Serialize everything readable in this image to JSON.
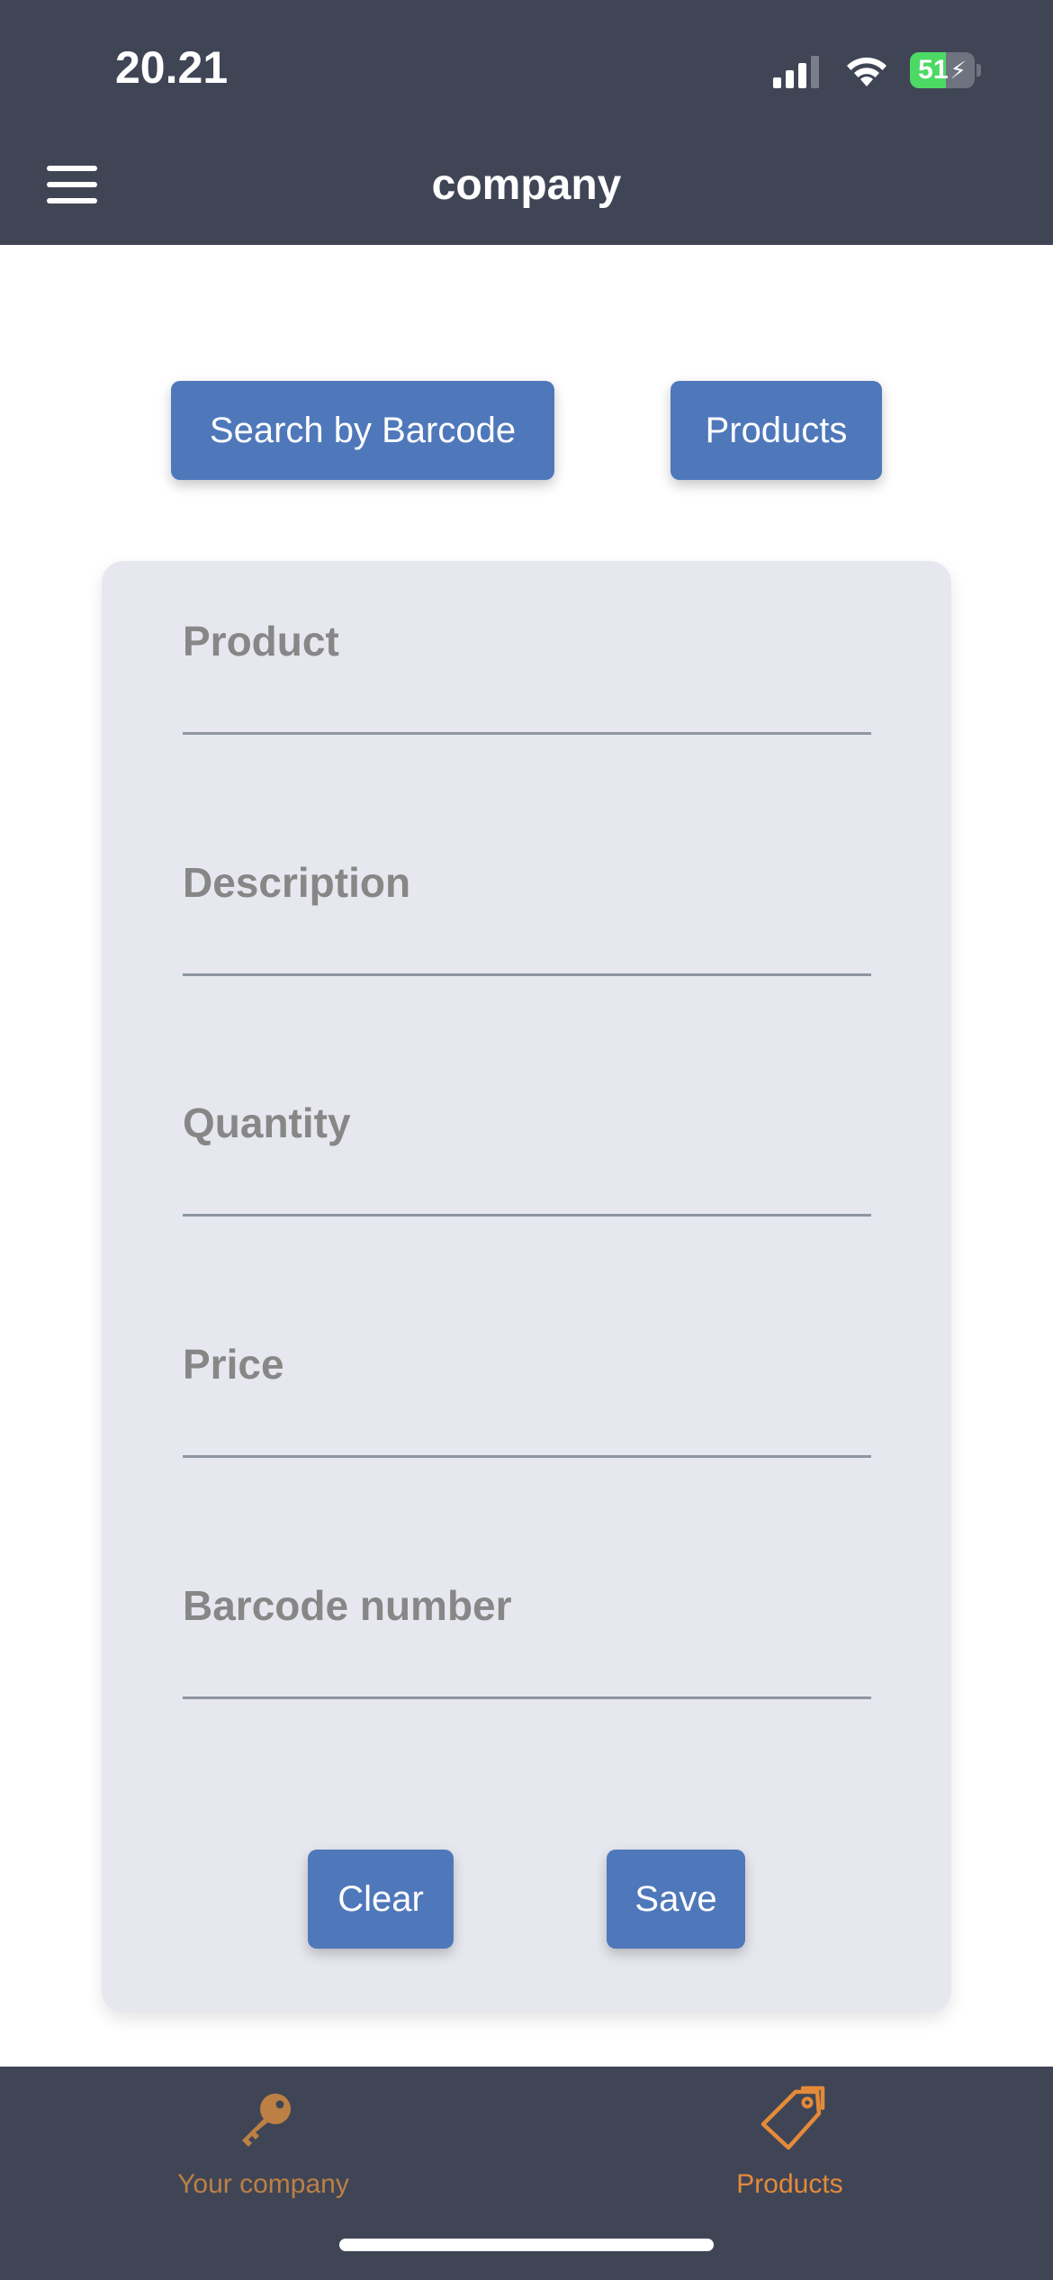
{
  "status_bar": {
    "time": "20.21",
    "battery_level": "51",
    "icons": [
      "cellular-signal-icon",
      "wifi-icon",
      "battery-charging-icon"
    ]
  },
  "navbar": {
    "title": "company",
    "menu_icon": "hamburger-menu-icon"
  },
  "actions": {
    "search_barcode_label": "Search by Barcode",
    "products_label": "Products"
  },
  "form": {
    "fields": [
      {
        "label": "Product",
        "value": "",
        "placeholder": ""
      },
      {
        "label": "Description",
        "value": "",
        "placeholder": ""
      },
      {
        "label": "Quantity",
        "value": "",
        "placeholder": ""
      },
      {
        "label": "Price",
        "value": "",
        "placeholder": ""
      },
      {
        "label": "Barcode number",
        "value": "",
        "placeholder": ""
      }
    ],
    "clear_label": "Clear",
    "save_label": "Save"
  },
  "tabbar": {
    "tabs": [
      {
        "label": "Your company",
        "icon": "key-icon",
        "active": false
      },
      {
        "label": "Products",
        "icon": "price-tag-icon",
        "active": true
      }
    ]
  },
  "colors": {
    "header_bg": "#404556",
    "button_bg": "#4f78bb",
    "card_bg": "#e7e8ef",
    "accent": "#e48a38",
    "battery_green": "#4cd964"
  }
}
